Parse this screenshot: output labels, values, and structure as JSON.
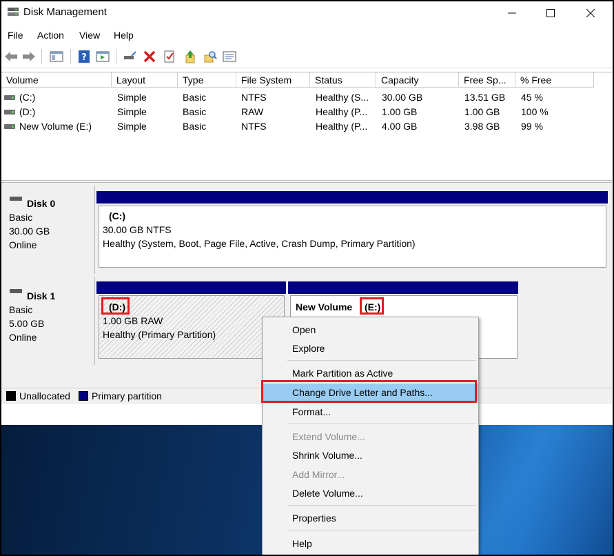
{
  "window": {
    "title": "Disk Management",
    "controls": {
      "minimize": "—",
      "maximize": "☐",
      "close": "✕"
    }
  },
  "menu": [
    "File",
    "Action",
    "View",
    "Help"
  ],
  "toolbar": {
    "icons": [
      "back-icon",
      "forward-icon",
      "console-tree-icon",
      "help-icon",
      "show-hide-icon",
      "connect-icon",
      "delete-icon",
      "properties-icon",
      "export-icon",
      "search-icon",
      "list-icon"
    ]
  },
  "volume_list": {
    "columns": [
      "Volume",
      "Layout",
      "Type",
      "File System",
      "Status",
      "Capacity",
      "Free Sp...",
      "% Free"
    ],
    "rows": [
      {
        "volume": "(C:)",
        "layout": "Simple",
        "type": "Basic",
        "fs": "NTFS",
        "status": "Healthy (S...",
        "capacity": "30.00 GB",
        "free": "13.51 GB",
        "pct": "45 %"
      },
      {
        "volume": "(D:)",
        "layout": "Simple",
        "type": "Basic",
        "fs": "RAW",
        "status": "Healthy (P...",
        "capacity": "1.00 GB",
        "free": "1.00 GB",
        "pct": "100 %"
      },
      {
        "volume": "New Volume (E:)",
        "layout": "Simple",
        "type": "Basic",
        "fs": "NTFS",
        "status": "Healthy (P...",
        "capacity": "4.00 GB",
        "free": "3.98 GB",
        "pct": "99 %"
      }
    ]
  },
  "disks": [
    {
      "name": "Disk 0",
      "type": "Basic",
      "size": "30.00 GB",
      "state": "Online",
      "partitions": [
        {
          "label": "(C:)",
          "size": "30.00 GB NTFS",
          "status": "Healthy (System, Boot, Page File, Active, Crash Dump, Primary Partition)"
        }
      ]
    },
    {
      "name": "Disk 1",
      "type": "Basic",
      "size": "5.00 GB",
      "state": "Online",
      "partitions": [
        {
          "label": "(D:)",
          "size": "1.00 GB RAW",
          "status": "Healthy (Primary Partition)"
        },
        {
          "label": "New Volume",
          "letter": "(E:)"
        }
      ]
    }
  ],
  "legend": [
    {
      "label": "Unallocated",
      "color": "#000000"
    },
    {
      "label": "Primary partition",
      "color": "#000080"
    }
  ],
  "context_menu": {
    "items": [
      {
        "label": "Open",
        "enabled": true
      },
      {
        "label": "Explore",
        "enabled": true
      },
      {
        "label": "Mark Partition as Active",
        "enabled": true
      },
      {
        "label": "Change Drive Letter and Paths...",
        "enabled": true,
        "highlighted": true
      },
      {
        "label": "Format...",
        "enabled": true
      },
      {
        "label": "Extend Volume...",
        "enabled": false
      },
      {
        "label": "Shrink Volume...",
        "enabled": true
      },
      {
        "label": "Add Mirror...",
        "enabled": false
      },
      {
        "label": "Delete Volume...",
        "enabled": true
      },
      {
        "label": "Properties",
        "enabled": true
      },
      {
        "label": "Help",
        "enabled": true
      }
    ]
  },
  "colors": {
    "primary_partition": "#000080",
    "highlight": "#99ccf3",
    "annotation_red": "#e11d22"
  }
}
